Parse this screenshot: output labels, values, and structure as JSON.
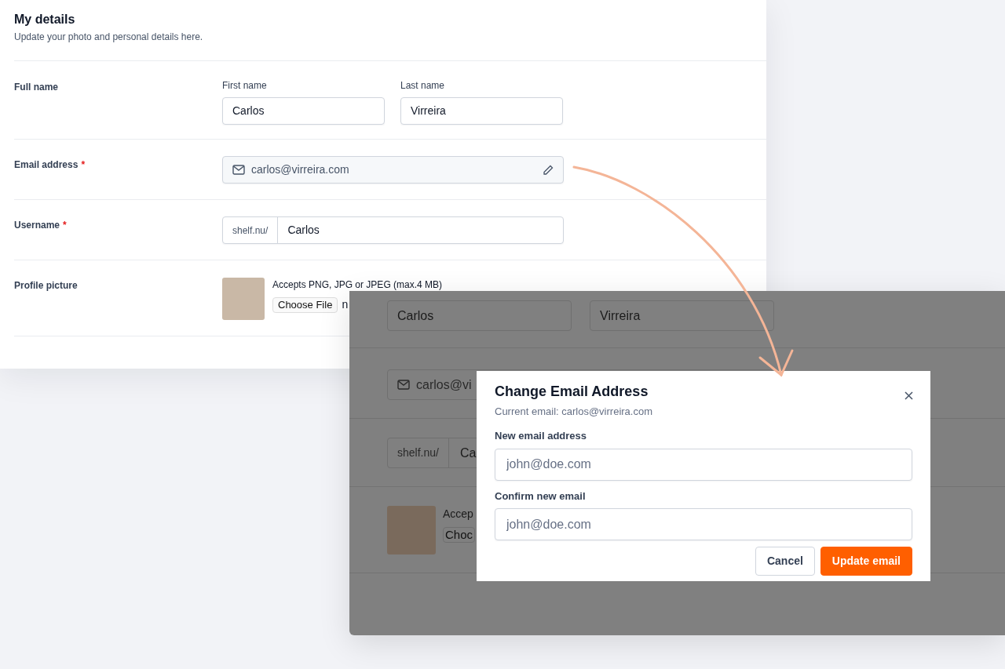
{
  "details": {
    "title": "My details",
    "subtitle": "Update your photo and personal details here.",
    "rows": [
      {
        "kind": "name",
        "label": "Full name",
        "fields": [
          {
            "label": "First name",
            "value": "Carlos"
          },
          {
            "label": "Last name",
            "value": "Virreira"
          }
        ]
      },
      {
        "kind": "email",
        "label": "Email address",
        "required_mark": "*",
        "value": "carlos@virreira.com"
      },
      {
        "kind": "username",
        "label": "Username",
        "required_mark": "*",
        "prefix": "shelf.nu/",
        "value": "Carlos"
      },
      {
        "kind": "picture",
        "label": "Profile picture",
        "hint": "Accepts PNG, JPG or JPEG (max.4 MB)",
        "button": "Choose File",
        "file_status": "n"
      }
    ]
  },
  "background_form": {
    "first_name": "Carlos",
    "last_name": "Virreira",
    "email": "carlos@vi",
    "prefix": "shelf.nu/",
    "username": "Ca",
    "hint": "Accep",
    "button": "Choc"
  },
  "modal": {
    "title": "Change Email Address",
    "subtitle": "Current email: carlos@virreira.com",
    "fields": [
      {
        "label": "New email address",
        "placeholder": "john@doe.com"
      },
      {
        "label": "Confirm new email",
        "placeholder": "john@doe.com"
      }
    ],
    "buttons": [
      {
        "label": "Cancel",
        "kind": "secondary"
      },
      {
        "label": "Update email",
        "kind": "primary"
      }
    ]
  }
}
